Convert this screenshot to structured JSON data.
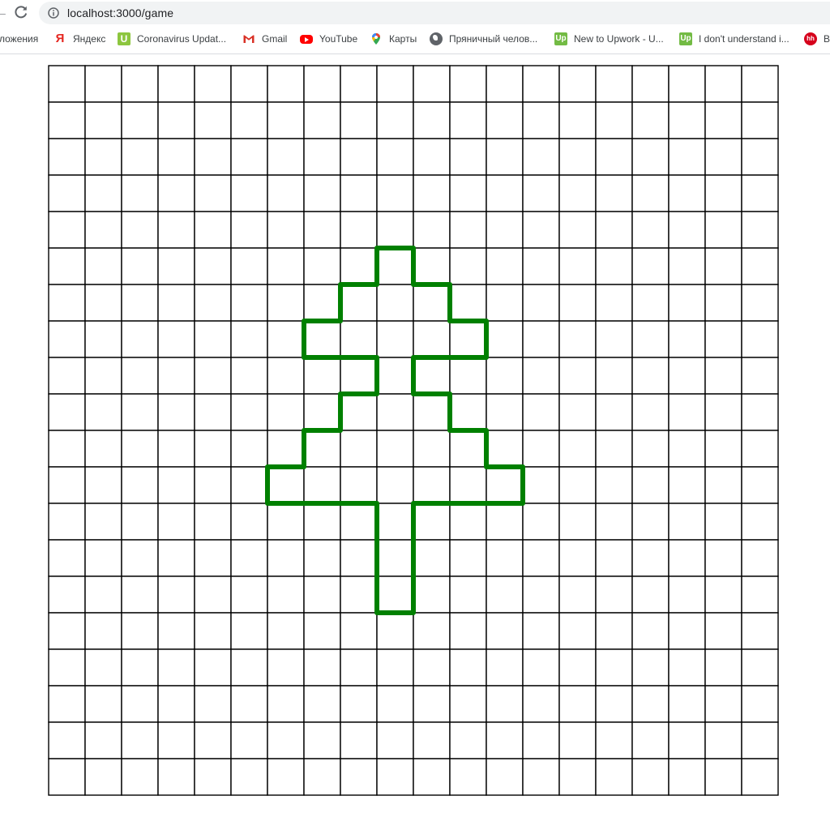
{
  "browser": {
    "url": "localhost:3000/game",
    "bookmarks": [
      {
        "label": "ложения",
        "icon": "none"
      },
      {
        "label": "Яндекс",
        "icon": "yandex-icon",
        "glyph": "Я"
      },
      {
        "label": "Coronavirus Updat...",
        "icon": "u-icon",
        "glyph": "U"
      },
      {
        "label": "Gmail",
        "icon": "gmail-icon"
      },
      {
        "label": "YouTube",
        "icon": "youtube-icon"
      },
      {
        "label": "Карты",
        "icon": "maps-pin-icon"
      },
      {
        "label": "Пряничный челов...",
        "icon": "globe-icon"
      },
      {
        "label": "New to Upwork - U...",
        "icon": "upwork-icon",
        "glyph": "Up"
      },
      {
        "label": "I don't understand i...",
        "icon": "upwork-icon",
        "glyph": "Up"
      },
      {
        "label": "B",
        "icon": "hh-icon",
        "glyph": "hh"
      }
    ]
  },
  "game": {
    "columns": 20,
    "rows": 20,
    "grid_color": "#000000",
    "path_color": "#008000",
    "path_vertices": [
      [
        9,
        5
      ],
      [
        10,
        5
      ],
      [
        10,
        6
      ],
      [
        11,
        6
      ],
      [
        11,
        7
      ],
      [
        12,
        7
      ],
      [
        12,
        8
      ],
      [
        10,
        8
      ],
      [
        10,
        9
      ],
      [
        11,
        9
      ],
      [
        11,
        10
      ],
      [
        12,
        10
      ],
      [
        12,
        11
      ],
      [
        13,
        11
      ],
      [
        13,
        12
      ],
      [
        10,
        12
      ],
      [
        10,
        15
      ],
      [
        9,
        15
      ],
      [
        9,
        12
      ],
      [
        6,
        12
      ],
      [
        6,
        11
      ],
      [
        7,
        11
      ],
      [
        7,
        10
      ],
      [
        8,
        10
      ],
      [
        8,
        9
      ],
      [
        9,
        9
      ],
      [
        9,
        8
      ],
      [
        7,
        8
      ],
      [
        7,
        7
      ],
      [
        8,
        7
      ],
      [
        8,
        6
      ],
      [
        9,
        6
      ]
    ]
  }
}
